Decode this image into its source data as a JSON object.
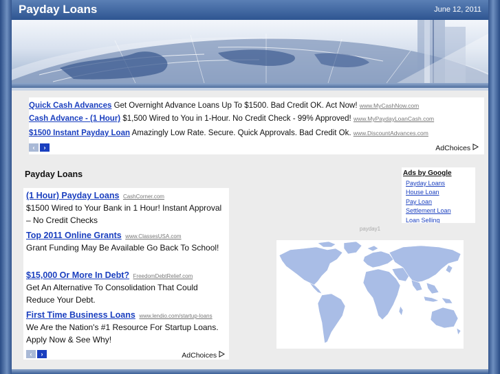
{
  "header": {
    "site_title": "Payday Loans",
    "date": "June 12, 2011"
  },
  "top_ads": {
    "items": [
      {
        "title": "Quick Cash Advances",
        "desc": "Get Overnight Advance Loans Up To $1500. Bad Credit OK. Act Now!",
        "url": "www.MyCashNow.com"
      },
      {
        "title": "Cash Advance - (1 Hour)",
        "desc": "$1,500 Wired to You in 1-Hour. No Credit Check - 99% Approved!",
        "url": "www.MyPaydayLoanCash.com"
      },
      {
        "title": "$1500 Instant Payday Loan",
        "desc": "Amazingly Low Rate. Secure. Quick Approvals. Bad Credit Ok.",
        "url": "www.DiscountAdvances.com"
      }
    ],
    "prev_icon": "‹",
    "next_icon": "›",
    "adchoices": "AdChoices"
  },
  "main": {
    "section_title": "Payday Loans"
  },
  "left_ads": {
    "items": [
      {
        "title": "(1 Hour) Payday Loans",
        "url": "CashCorner.com",
        "desc": "$1500 Wired to Your Bank in 1 Hour! Instant Approval – No Credit Checks"
      },
      {
        "title": "Top 2011 Online Grants",
        "url": "www.ClassesUSA.com",
        "desc": "Grant Funding May Be Available Go Back To School!"
      },
      {
        "title": "$15,000 Or More In Debt?",
        "url": "FreedomDebtRelief.com",
        "desc": "Get An Alternative To Consolidation That Could Reduce Your Debt."
      },
      {
        "title": "First Time Business Loans",
        "url": "www.lendio.com/startup-loans",
        "desc": "We Are the Nation's #1 Resource For Startup Loans. Apply Now & See Why!"
      }
    ],
    "prev_icon": "‹",
    "next_icon": "›",
    "adchoices": "AdChoices"
  },
  "google_ads": {
    "title": "Ads by Google",
    "items": [
      "Payday Loans",
      "House Loan",
      "Pay Loan",
      "Settlement Loan",
      "Loan Selling"
    ]
  },
  "map": {
    "caption": "payday1"
  },
  "icons": {
    "adchoices_icon": "adchoices-triangle-icon",
    "world_map": "world-map-icon"
  },
  "colors": {
    "header_blue": "#2e5591",
    "link_blue": "#1a3fbf",
    "page_bg": "#ececec",
    "map_land": "#9fb5e3"
  }
}
